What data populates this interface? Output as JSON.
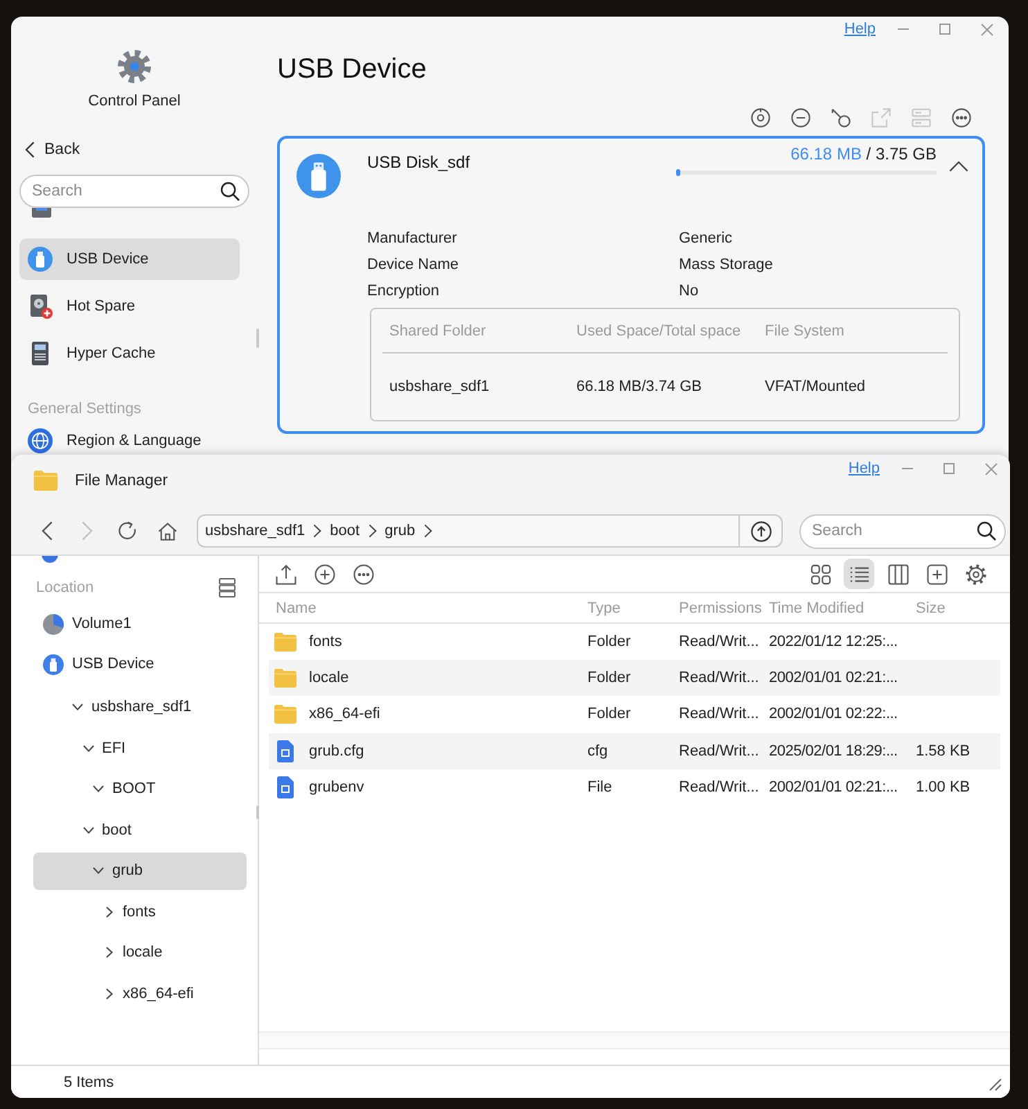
{
  "control_panel": {
    "app_title": "Control Panel",
    "back": "Back",
    "search": {
      "placeholder": "Search"
    },
    "sidebar_items": [
      {
        "label": "USB Device",
        "kind": "usb",
        "selected": true
      },
      {
        "label": "Hot Spare",
        "kind": "spare",
        "selected": false
      },
      {
        "label": "Hyper Cache",
        "kind": "cache",
        "selected": false
      }
    ],
    "section_title": "General Settings",
    "section_items": [
      {
        "label": "Region & Language",
        "kind": "globe",
        "selected": false
      }
    ],
    "help": "Help",
    "page_title": "USB Device",
    "toolbar": [
      {
        "disabled": false
      },
      {
        "disabled": false
      },
      {
        "disabled": false
      },
      {
        "disabled": true
      },
      {
        "disabled": true
      },
      {
        "disabled": false
      }
    ],
    "device": {
      "name": "USB Disk_sdf",
      "used": "66.18 MB",
      "total": "/ 3.75 GB",
      "level": 0.018,
      "expanded": true,
      "details": [
        {
          "label": "Manufacturer",
          "value": "Generic"
        },
        {
          "label": "Device Name",
          "value": "Mass Storage"
        },
        {
          "label": "Encryption",
          "value": "No"
        }
      ],
      "table": {
        "columns": [
          "Shared Folder",
          "Used Space/Total space",
          "File System"
        ],
        "rows": [
          [
            "usbshare_sdf1",
            "66.18 MB/3.74 GB",
            "VFAT/Mounted"
          ]
        ]
      }
    }
  },
  "file_manager": {
    "title": "File Manager",
    "help": "Help",
    "nav": [
      {
        "disabled": false
      },
      {
        "disabled": true
      }
    ],
    "path": [
      "usbshare_sdf1",
      "boot",
      "grub"
    ],
    "search": {
      "placeholder": "Search"
    },
    "location_title": "Location",
    "locations": [
      {
        "name": "Volume1",
        "kind": "volume",
        "selected": false
      },
      {
        "name": "USB Device",
        "kind": "usb",
        "selected": false,
        "children": [
          {
            "name": "usbshare_sdf1",
            "expanded": true,
            "selected": false,
            "children": [
              {
                "name": "EFI",
                "expanded": true,
                "selected": false,
                "children": [
                  {
                    "name": "BOOT",
                    "expanded": true,
                    "selected": false
                  }
                ]
              },
              {
                "name": "boot",
                "expanded": true,
                "selected": false,
                "children": [
                  {
                    "name": "grub",
                    "expanded": true,
                    "selected": true,
                    "children": [
                      {
                        "name": "fonts",
                        "expanded": false,
                        "selected": false
                      },
                      {
                        "name": "locale",
                        "expanded": false,
                        "selected": false
                      },
                      {
                        "name": "x86_64-efi",
                        "expanded": false,
                        "selected": false
                      }
                    ]
                  }
                ]
              }
            ]
          }
        ]
      }
    ],
    "views": [
      {
        "selected": false
      },
      {
        "selected": true
      },
      {
        "selected": false
      }
    ],
    "columns": [
      "Name",
      "Type",
      "Permissions",
      "Time Modified",
      "Size"
    ],
    "files": [
      {
        "kind": "folder",
        "name": "fonts",
        "type": "Folder",
        "permissions": "Read/Writ...",
        "modified": "2022/01/12 12:25:..."
      },
      {
        "kind": "folder",
        "name": "locale",
        "type": "Folder",
        "permissions": "Read/Writ...",
        "modified": "2002/01/01 02:21:..."
      },
      {
        "kind": "folder",
        "name": "x86_64-efi",
        "type": "Folder",
        "permissions": "Read/Writ...",
        "modified": "2002/01/01 02:22:..."
      },
      {
        "kind": "file",
        "name": "grub.cfg",
        "type": "cfg",
        "permissions": "Read/Writ...",
        "modified": "2025/02/01 18:29:...",
        "size": "1.58 KB"
      },
      {
        "kind": "file",
        "name": "grubenv",
        "type": "File",
        "permissions": "Read/Writ...",
        "modified": "2002/01/01 02:21:...",
        "size": "1.00 KB"
      }
    ],
    "status": "5 Items"
  }
}
